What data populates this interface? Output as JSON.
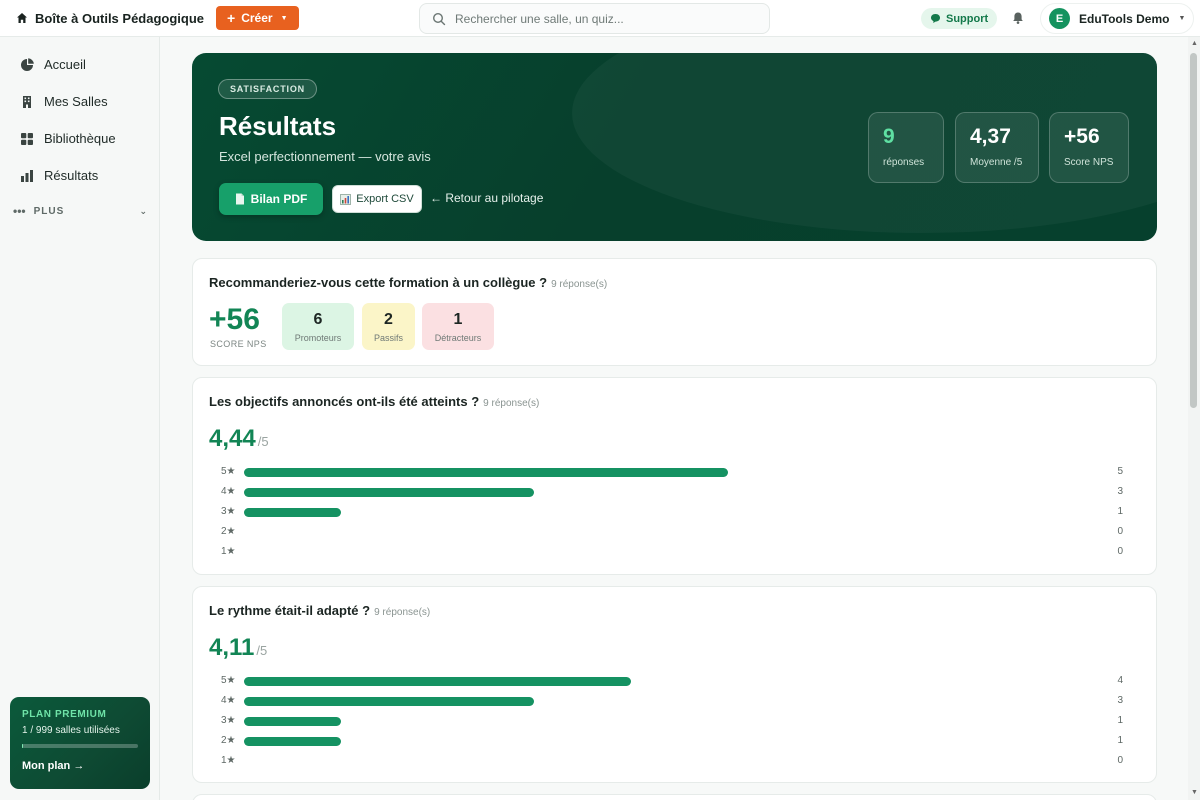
{
  "topbar": {
    "brand": "Boîte à Outils Pédagogique",
    "create_label": "Créer",
    "search_placeholder": "Rechercher une salle, un quiz...",
    "support_label": "Support",
    "user_initial": "E",
    "user_name": "EduTools Demo"
  },
  "sidebar": {
    "items": [
      {
        "label": "Accueil",
        "icon": "chart-pie-icon"
      },
      {
        "label": "Mes Salles",
        "icon": "building-icon"
      },
      {
        "label": "Bibliothèque",
        "icon": "grid-icon"
      },
      {
        "label": "Résultats",
        "icon": "bar-chart-icon"
      }
    ],
    "more_label": "PLUS",
    "plan": {
      "title": "PLAN PREMIUM",
      "usage": "1 / 999 salles utilisées",
      "usage_fraction": 0.001,
      "link": "Mon plan →"
    }
  },
  "hero": {
    "tag": "SATISFACTION",
    "title": "Résultats",
    "subtitle": "Excel perfectionnement — votre avis",
    "pdf_label": "Bilan PDF",
    "csv_label": "Export CSV",
    "back_label": "← Retour au pilotage",
    "stats": [
      {
        "value": "9",
        "label": "réponses"
      },
      {
        "value": "4,37",
        "label": "Moyenne /5"
      },
      {
        "value": "+56",
        "label": "Score NPS"
      }
    ]
  },
  "nps_card": {
    "question": "Recommanderiez-vous cette formation à un collègue ?",
    "responses": "9 réponse(s)",
    "score": "+56",
    "score_label": "SCORE NPS",
    "promoters": {
      "value": "6",
      "label": "Promoteurs"
    },
    "passives": {
      "value": "2",
      "label": "Passifs"
    },
    "detractors": {
      "value": "1",
      "label": "Détracteurs"
    }
  },
  "questions": [
    {
      "question": "Les objectifs annoncés ont-ils été atteints ?",
      "responses": "9 réponse(s)",
      "average": "4,44",
      "scale": "/5",
      "rows": [
        {
          "label": "5★",
          "count": 5
        },
        {
          "label": "4★",
          "count": 3
        },
        {
          "label": "3★",
          "count": 1
        },
        {
          "label": "2★",
          "count": 0
        },
        {
          "label": "1★",
          "count": 0
        }
      ]
    },
    {
      "question": "Le rythme était-il adapté ?",
      "responses": "9 réponse(s)",
      "average": "4,11",
      "scale": "/5",
      "rows": [
        {
          "label": "5★",
          "count": 4
        },
        {
          "label": "4★",
          "count": 3
        },
        {
          "label": "3★",
          "count": 1
        },
        {
          "label": "2★",
          "count": 1
        },
        {
          "label": "1★",
          "count": 0
        }
      ]
    }
  ],
  "colors": {
    "accent": "#128555",
    "create": "#e8611f",
    "hero": "#064a32",
    "promoters_bg": "#dcf5e4",
    "passives_bg": "#fbf5c8",
    "detractors_bg": "#fbe0e2"
  }
}
